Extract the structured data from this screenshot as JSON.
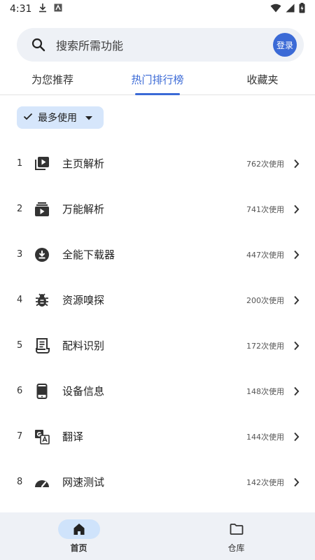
{
  "status_bar": {
    "time": "4:31"
  },
  "search": {
    "placeholder": "搜索所需功能",
    "login_label": "登录"
  },
  "tabs": [
    {
      "label": "为您推荐",
      "active": false
    },
    {
      "label": "热门排行榜",
      "active": true
    },
    {
      "label": "收藏夹",
      "active": false
    }
  ],
  "filter": {
    "label": "最多使用"
  },
  "ranking": [
    {
      "rank": "1",
      "label": "主页解析",
      "count": "762次使用",
      "icon": "video-library-icon"
    },
    {
      "rank": "2",
      "label": "万能解析",
      "count": "741次使用",
      "icon": "play-stack-icon"
    },
    {
      "rank": "3",
      "label": "全能下载器",
      "count": "447次使用",
      "icon": "download-circle-icon"
    },
    {
      "rank": "4",
      "label": "资源嗅探",
      "count": "200次使用",
      "icon": "bug-icon"
    },
    {
      "rank": "5",
      "label": "配料识别",
      "count": "172次使用",
      "icon": "receipt-icon"
    },
    {
      "rank": "6",
      "label": "设备信息",
      "count": "148次使用",
      "icon": "phone-icon"
    },
    {
      "rank": "7",
      "label": "翻译",
      "count": "144次使用",
      "icon": "translate-icon"
    },
    {
      "rank": "8",
      "label": "网速测试",
      "count": "142次使用",
      "icon": "speedometer-icon"
    }
  ],
  "bottom_nav": [
    {
      "label": "首页",
      "active": true
    },
    {
      "label": "仓库",
      "active": false
    }
  ],
  "colors": {
    "accent": "#3b6ad6",
    "chip": "#d6e6fb",
    "surface": "#eef1f6"
  }
}
